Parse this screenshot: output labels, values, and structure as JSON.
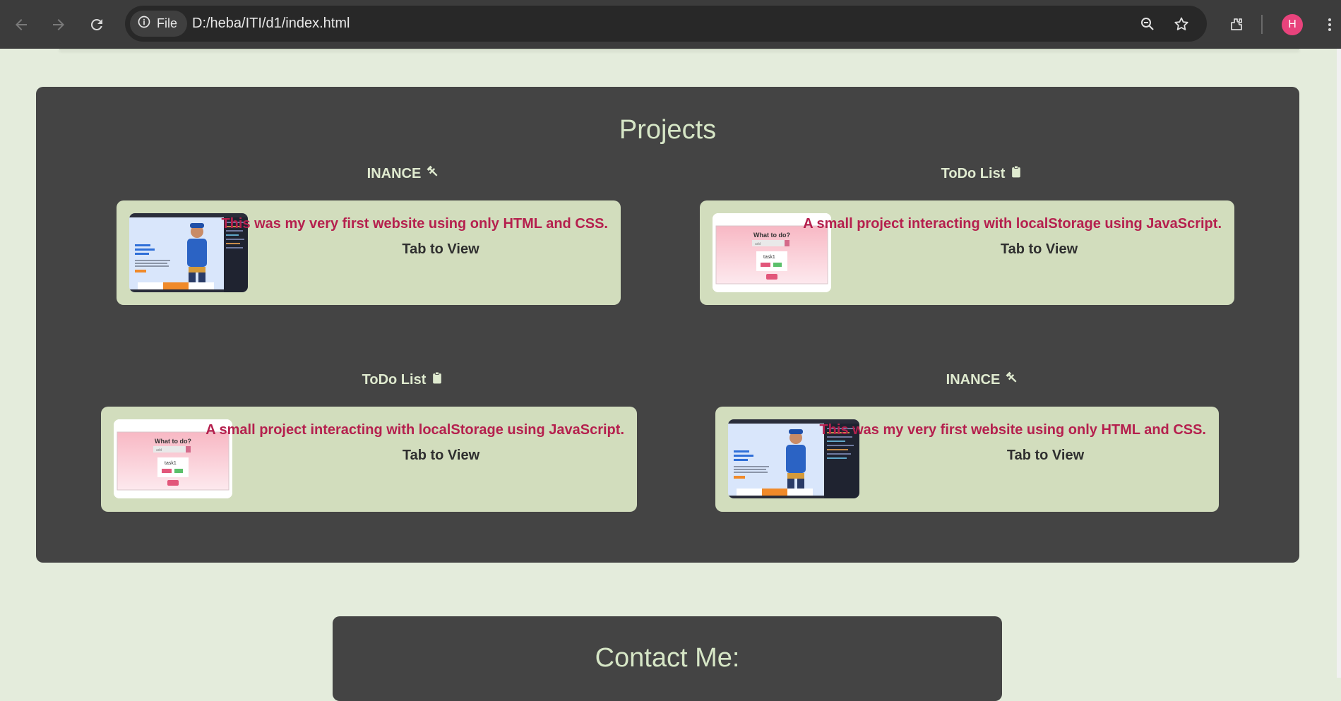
{
  "browser": {
    "site_chip_label": "File",
    "url": "D:/heba/ITI/d1/index.html",
    "profile_initial": "H",
    "icons": [
      "back-arrow-icon",
      "forward-arrow-icon",
      "reload-icon",
      "info-icon",
      "zoom-out-icon",
      "star-icon",
      "extensions-icon",
      "kebab-menu-icon"
    ]
  },
  "projects": {
    "heading": "Projects",
    "items": [
      {
        "title": "INANCE",
        "icon": "hammer-icon",
        "description": "This was my very first website using only HTML and CSS.",
        "link_label": "Tab to View"
      },
      {
        "title": "ToDo List",
        "icon": "clipboard-icon",
        "description": "A small project interacting with localStorage using JavaScript.",
        "link_label": "Tab to View",
        "thumb_text": {
          "heading": "What to do?",
          "task": "task1",
          "input": "add"
        }
      },
      {
        "title": "ToDo List",
        "icon": "clipboard-icon",
        "description": "A small project interacting with localStorage using JavaScript.",
        "link_label": "Tab to View",
        "thumb_text": {
          "heading": "What to do?",
          "task": "task1",
          "input": "add"
        }
      },
      {
        "title": "INANCE",
        "icon": "hammer-icon",
        "description": "This was my very first website using only HTML and CSS.",
        "link_label": "Tab to View"
      }
    ]
  },
  "contact": {
    "heading": "Contact Me:"
  },
  "colors": {
    "page_bg": "#e4ecdc",
    "section_bg": "#444444",
    "card_bg": "#d2ddbd",
    "description_text": "#b5204e",
    "heading_text": "#d6e6c6",
    "avatar": "#e8437c"
  }
}
